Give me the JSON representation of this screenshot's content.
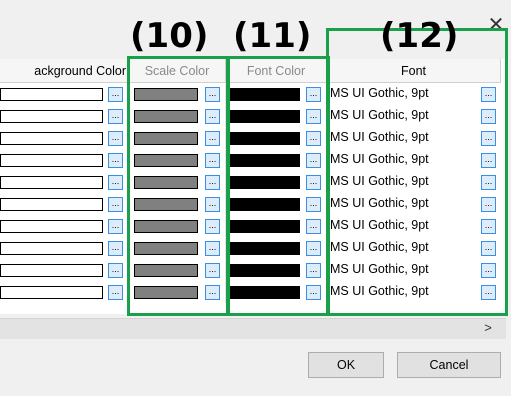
{
  "window": {
    "close_glyph": "✕"
  },
  "columns": {
    "background_color": "ackground Color",
    "scale_color": "Scale Color",
    "font_color": "Font Color",
    "font": "Font"
  },
  "callouts": {
    "c10": "(10)",
    "c11": "(11)",
    "c12": "(12)"
  },
  "rows": [
    {
      "font": "MS UI Gothic, 9pt"
    },
    {
      "font": "MS UI Gothic, 9pt"
    },
    {
      "font": "MS UI Gothic, 9pt"
    },
    {
      "font": "MS UI Gothic, 9pt"
    },
    {
      "font": "MS UI Gothic, 9pt"
    },
    {
      "font": "MS UI Gothic, 9pt"
    },
    {
      "font": "MS UI Gothic, 9pt"
    },
    {
      "font": "MS UI Gothic, 9pt"
    },
    {
      "font": "MS UI Gothic, 9pt"
    },
    {
      "font": "MS UI Gothic, 9pt"
    }
  ],
  "browse_label": "...",
  "scroll_right_glyph": ">",
  "buttons": {
    "ok": "OK",
    "cancel": "Cancel"
  },
  "colors": {
    "scale_swatch": "#808080",
    "font_swatch": "#000000",
    "background_swatch": "#ffffff",
    "highlight_border": "#1aa04a",
    "browse_button_border": "#3a8ee6"
  }
}
